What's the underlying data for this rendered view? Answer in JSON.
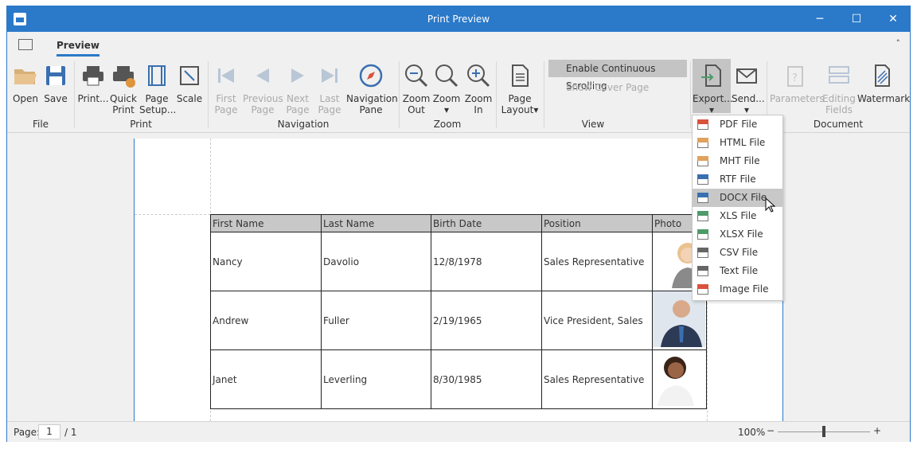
{
  "window": {
    "title": "Print Preview",
    "minimize": "─",
    "maximize": "☐",
    "close": "✕"
  },
  "tabs": [
    {
      "label": "Preview",
      "active": true
    }
  ],
  "ribbon": {
    "file": {
      "label": "File",
      "open": "Open",
      "save": "Save"
    },
    "print": {
      "label": "Print",
      "print": "Print...",
      "quick1": "Quick",
      "quick2": "Print",
      "setup1": "Page",
      "setup2": "Setup...",
      "scale": "Scale"
    },
    "navigation": {
      "label": "Navigation",
      "first1": "First",
      "first2": "Page",
      "prev1": "Previous",
      "prev2": "Page",
      "next1": "Next",
      "next2": "Page",
      "last1": "Last",
      "last2": "Page",
      "pane1": "Navigation",
      "pane2": "Pane"
    },
    "zoom": {
      "label": "Zoom",
      "out1": "Zoom",
      "out2": "Out",
      "zoom": "Zoom",
      "in1": "Zoom",
      "in2": "In"
    },
    "layout": {
      "l1": "Page",
      "l2": "Layout"
    },
    "view": {
      "label": "View",
      "continuous": "Enable Continuous Scrolling",
      "cover": "Show Cover Page"
    },
    "export": {
      "export": "Export...",
      "send": "Send..."
    },
    "document": {
      "label": "Document",
      "parameters": "Parameters",
      "edit1": "Editing",
      "edit2": "Fields",
      "watermark": "Watermark"
    }
  },
  "export_menu": [
    {
      "label": "PDF File",
      "color": "#d9533c"
    },
    {
      "label": "HTML File",
      "color": "#e0a25e"
    },
    {
      "label": "MHT File",
      "color": "#e0a25e"
    },
    {
      "label": "RTF File",
      "color": "#3a6fb0"
    },
    {
      "label": "DOCX File",
      "color": "#3a6fb0",
      "highlighted": true
    },
    {
      "label": "XLS File",
      "color": "#4f9a6a"
    },
    {
      "label": "XLSX File",
      "color": "#4f9a6a"
    },
    {
      "label": "CSV File",
      "color": "#666666"
    },
    {
      "label": "Text File",
      "color": "#666666"
    },
    {
      "label": "Image File",
      "color": "#d9533c"
    }
  ],
  "table": {
    "headers": [
      "First Name",
      "Last Name",
      "Birth Date",
      "Position",
      "Photo"
    ],
    "rows": [
      [
        "Nancy",
        "Davolio",
        "12/8/1978",
        "Sales Representative"
      ],
      [
        "Andrew",
        "Fuller",
        "2/19/1965",
        "Vice President, Sales"
      ],
      [
        "Janet",
        "Leverling",
        "8/30/1985",
        "Sales Representative"
      ]
    ]
  },
  "status": {
    "page_label": "Page:",
    "page_value": "1",
    "page_total": "/ 1",
    "zoom": "100%",
    "zoom_out": "−",
    "zoom_in": "+"
  },
  "colors": {
    "accent": "#2b79c9"
  }
}
